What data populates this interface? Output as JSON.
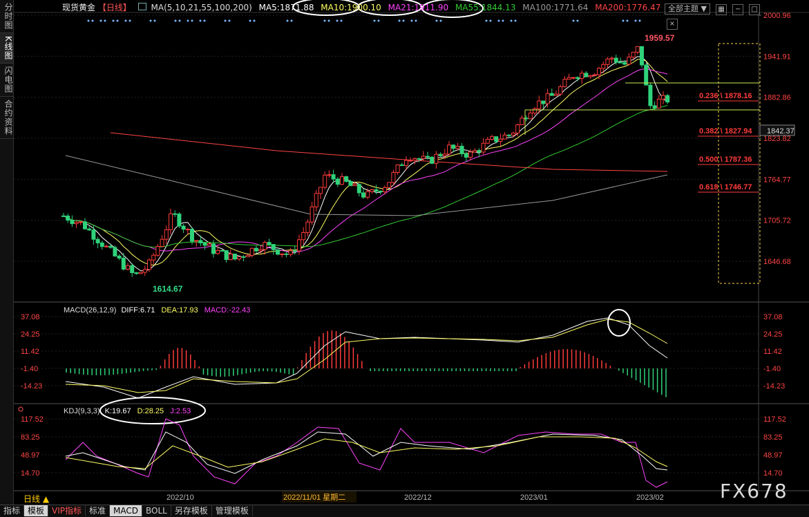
{
  "left_tabs": [
    {
      "label": "分时图",
      "active": false
    },
    {
      "label": "K线图",
      "active": true
    },
    {
      "label": "闪电图",
      "active": false
    },
    {
      "label": "合约资料",
      "active": false
    }
  ],
  "header": {
    "instrument": "现货黄金",
    "period_tag": "【日线】",
    "ma_params": "MA(5,10,21,55,100,200)",
    "ma5": "MA5:1871.88",
    "ma10": "MA10:1900.10",
    "ma21": "MA21:1911.90",
    "ma55": "MA55:1844.13",
    "ma100": "MA100:1771.64",
    "ma200": "MA200:1776.47",
    "selector": "全部主题",
    "selector_arrow": "▼"
  },
  "price_axis": [
    "2000.96",
    "1941.91",
    "1882.86",
    "1823.82",
    "1764.77",
    "1705.72",
    "1646.68"
  ],
  "current_price": "1842.37",
  "fib_levels": [
    {
      "label": "0.236 \\ 1878.16"
    },
    {
      "label": "0.382 \\ 1827.94"
    },
    {
      "label": "0.500 \\ 1787.36"
    },
    {
      "label": "0.618 \\ 1746.77"
    }
  ],
  "annotations": {
    "high": "1959.57",
    "low": "1614.67"
  },
  "macd": {
    "title": "MACD(26,12,9)",
    "diff": "DIFF:6.71",
    "dea": "DEA:17.93",
    "macd": "MACD:-22.43",
    "axis": [
      "37.08",
      "24.25",
      "11.42",
      "-1.40",
      "-14.23"
    ]
  },
  "kdj": {
    "title": "KDJ(9,3,3)",
    "k": "K:19.67",
    "d": "D:28.25",
    "j": "J:2.53",
    "axis": [
      "117.52",
      "83.25",
      "48.97",
      "14.70"
    ]
  },
  "time_axis": {
    "labels": [
      "2022/10",
      "2022/12",
      "2023/01",
      "2023/02"
    ],
    "cursor_label": "2022/11/01 星期二"
  },
  "period": "日线 ▲",
  "bottom_tabs": [
    {
      "label": "指标",
      "active": false
    },
    {
      "label": "模板",
      "active": true
    },
    {
      "label": "VIP指标",
      "active": false
    },
    {
      "label": "标准",
      "active": false
    },
    {
      "label": "MACD",
      "active": true
    },
    {
      "label": "BOLL",
      "active": false
    },
    {
      "label": "另存模板",
      "active": false
    },
    {
      "label": "管理模板",
      "active": false
    }
  ],
  "watermark": "FX678",
  "colors": {
    "up": "#ff3b3b",
    "down": "#2fd27a",
    "ma5": "#ffffff",
    "ma10": "#ffff66",
    "ma21": "#ff44ff",
    "ma55": "#33cc33",
    "ma100": "#999999",
    "ma200": "#ff4444",
    "axis_text": "#ff4444",
    "fib": "#ffd54a"
  }
}
